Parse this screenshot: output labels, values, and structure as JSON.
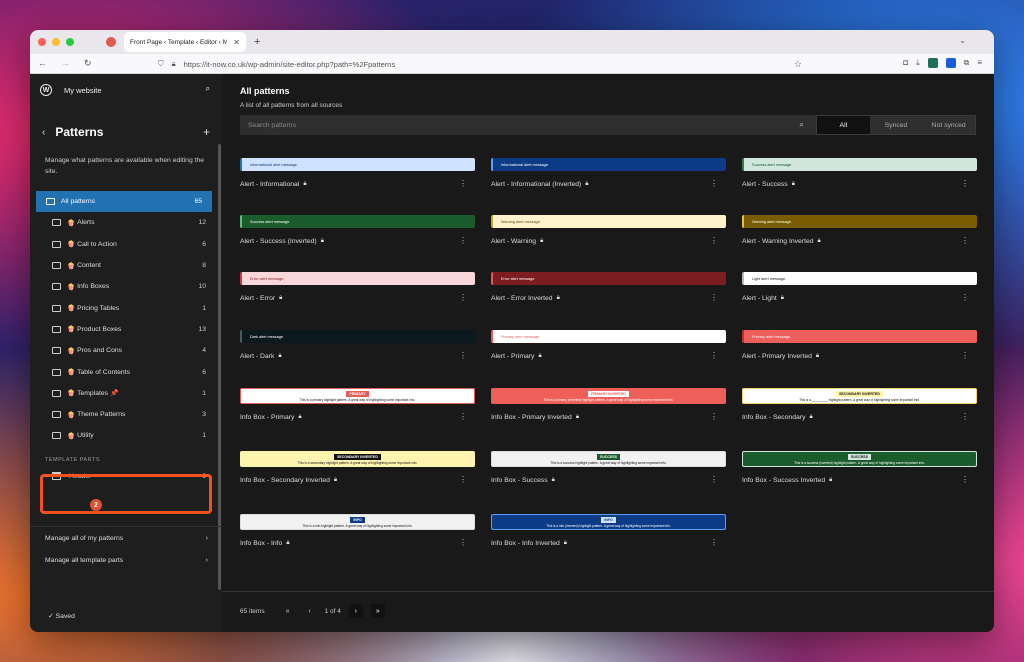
{
  "browser": {
    "tab_title": "Front Page ‹ Template ‹ Editor ‹ My",
    "url": "https://it-now.co.uk/wp-admin/site-editor.php?path=%2Fpatterns"
  },
  "sidebar": {
    "site_name": "My website",
    "title": "Patterns",
    "description": "Manage what patterns are available when editing the site.",
    "items": [
      {
        "label": "All patterns",
        "count": "65",
        "emoji": ""
      },
      {
        "label": "Alerts",
        "count": "12",
        "emoji": "🍿"
      },
      {
        "label": "Call to Action",
        "count": "6",
        "emoji": "🍿"
      },
      {
        "label": "Content",
        "count": "8",
        "emoji": "🍿"
      },
      {
        "label": "Info Boxes",
        "count": "10",
        "emoji": "🍿"
      },
      {
        "label": "Pricing Tables",
        "count": "1",
        "emoji": "🍿"
      },
      {
        "label": "Product Boxes",
        "count": "13",
        "emoji": "🍿"
      },
      {
        "label": "Pros and Cons",
        "count": "4",
        "emoji": "🍿"
      },
      {
        "label": "Table of Contents",
        "count": "6",
        "emoji": "🍿"
      },
      {
        "label": "Templates 📌",
        "count": "1",
        "emoji": "🍿"
      },
      {
        "label": "Theme Patterns",
        "count": "3",
        "emoji": "🍿"
      },
      {
        "label": "Utility",
        "count": "1",
        "emoji": "🍿"
      }
    ],
    "template_parts_heading": "TEMPLATE PARTS",
    "template_parts": [
      {
        "label": "Header",
        "count": "6"
      }
    ],
    "badge": "2",
    "links": [
      "Manage all of my patterns",
      "Manage all template parts"
    ],
    "saved": "✓  Saved"
  },
  "main": {
    "title": "All patterns",
    "subtitle": "A list of all patterns from all sources",
    "search_placeholder": "Search patterns",
    "filters": [
      "All",
      "Synced",
      "Not synced"
    ],
    "cards": [
      {
        "label": "Alert - Informational",
        "text": "Informational alert message.",
        "bg": "#cfe2ff",
        "fg": "#0a3a7a",
        "bar": "#2271b1"
      },
      {
        "label": "Alert - Informational (Inverted)",
        "text": "Informational alert message.",
        "bg": "#0d3b85",
        "fg": "#ffffff",
        "bar": "#5aa0ff"
      },
      {
        "label": "Alert - Success",
        "text": "Success alert message.",
        "bg": "#d1e7dd",
        "fg": "#0f5132",
        "bar": "#2e7d4f"
      },
      {
        "label": "Alert - Success (Inverted)",
        "text": "Success alert message.",
        "bg": "#1a5c2c",
        "fg": "#ffffff",
        "bar": "#5cc27d"
      },
      {
        "label": "Alert - Warning",
        "text": "Warning alert message.",
        "bg": "#fff3cd",
        "fg": "#664d03",
        "bar": "#caa22c"
      },
      {
        "label": "Alert - Warning Inverted",
        "text": "Warning alert message.",
        "bg": "#7a5d00",
        "fg": "#ffffff",
        "bar": "#e6c04a"
      },
      {
        "label": "Alert - Error",
        "text": "Error alert message.",
        "bg": "#f8d7da",
        "fg": "#842029",
        "bar": "#d63343"
      },
      {
        "label": "Alert - Error Inverted",
        "text": "Error alert message.",
        "bg": "#7c1d22",
        "fg": "#ffffff",
        "bar": "#e25563"
      },
      {
        "label": "Alert - Light",
        "text": "Light alert message.",
        "bg": "#ffffff",
        "fg": "#222222",
        "bar": "#bbbbbb"
      },
      {
        "label": "Alert - Dark",
        "text": "Dark alert message.",
        "bg": "#0c1a1f",
        "fg": "#ffffff",
        "bar": "#4a5a60"
      },
      {
        "label": "Alert - Primary",
        "text": "Primary alert message.",
        "bg": "#ffffff",
        "fg": "#e35d5b",
        "bar": "#e35d5b"
      },
      {
        "label": "Alert - Primary Inverted",
        "text": "Primary alert message.",
        "bg": "#ec5f5a",
        "fg": "#ffffff",
        "bar": "#c0302c"
      },
      {
        "label": "Info Box - Primary",
        "tag": "PRIMARY",
        "text": "This is a primary highlight pattern. A great way of highlighting some important info.",
        "box": "#ffffff",
        "border": "#e35d5b",
        "tagbg": "#e35d5b",
        "tagfg": "#ffffff",
        "fg": "#111111"
      },
      {
        "label": "Info Box - Primary Inverted",
        "tag": "PRIMARY INVERTED",
        "text": "This is a primary (inverted) highlight pattern. A great way of highlighting some important info.",
        "box": "#ef5f59",
        "border": "#ef5f59",
        "tagbg": "#ffffff",
        "tagfg": "#e35d5b",
        "fg": "#ffffff"
      },
      {
        "label": "Info Box - Secondary",
        "tag": "SECONDARY INVERTED",
        "text": "This is a _________ highlight pattern. A great way of highlighting some important info.",
        "box": "#ffffff",
        "border": "#f3d467",
        "tagbg": "#fff3a8",
        "tagfg": "#111111",
        "fg": "#111111"
      },
      {
        "label": "Info Box - Secondary Inverted",
        "tag": "SECONDARY INVERTED",
        "text": "This is a secondary highlight pattern. A great way of highlighting some important info.",
        "box": "#fff3b0",
        "border": "#fff3b0",
        "tagbg": "#111111",
        "tagfg": "#ffffff",
        "fg": "#111111"
      },
      {
        "label": "Info Box - Success",
        "tag": "SUCCESS",
        "text": "This is a success highlight pattern. A great way of highlighting some important info.",
        "box": "#f2f2f2",
        "border": "#dddddd",
        "tagbg": "#1a5c2c",
        "tagfg": "#ffffff",
        "fg": "#111111"
      },
      {
        "label": "Info Box - Success Inverted",
        "tag": "SUCCESS",
        "text": "This is a success (inverted) highlight pattern. A great way of highlighting some important info.",
        "box": "#1a5c2c",
        "border": "#d1e7dd",
        "tagbg": "#d1e7dd",
        "tagfg": "#111111",
        "fg": "#ffffff"
      },
      {
        "label": "Info Box - Info",
        "tag": "INFO",
        "text": "This is a info highlight pattern. A great way of highlighting some important info.",
        "box": "#f2f2f2",
        "border": "#dddddd",
        "tagbg": "#0d3b85",
        "tagfg": "#ffffff",
        "fg": "#111111"
      },
      {
        "label": "Info Box - Info Inverted",
        "tag": "INFO",
        "text": "This is a info (inverted) highlight pattern. A great way of highlighting some important info.",
        "box": "#0d3b85",
        "border": "#5aa0ff",
        "tagbg": "#cfe2ff",
        "tagfg": "#0d3b85",
        "fg": "#ffffff"
      }
    ],
    "pagination": {
      "total": "65 items",
      "first": "«",
      "prev": "‹",
      "page": "1 of 4",
      "next": "›",
      "last": "»"
    }
  }
}
